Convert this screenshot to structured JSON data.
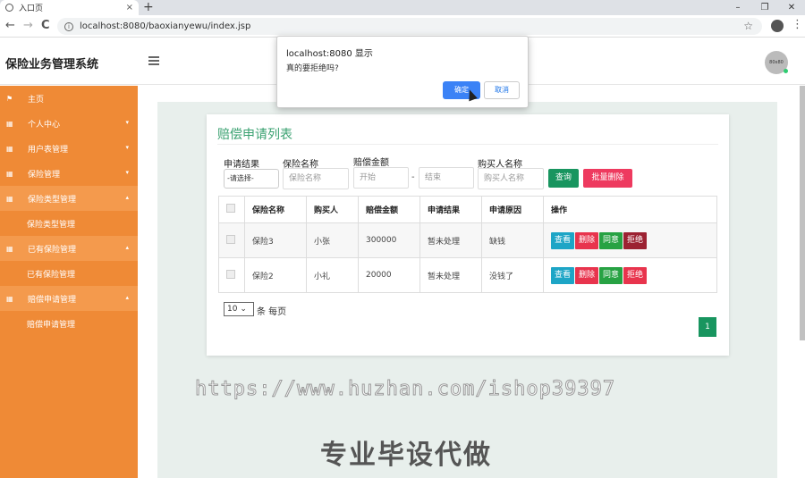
{
  "browser": {
    "tab_title": "入口页",
    "tab_close": "×",
    "new_tab": "+",
    "url": "localhost:8080/baoxianyewu/index.jsp",
    "back": "←",
    "forward": "→",
    "reload": "C",
    "info": "i",
    "star": "☆",
    "kebab": "⋮",
    "min": "–",
    "max": "❐",
    "close": "✕"
  },
  "header": {
    "title": "保险业务管理系统",
    "avatar_text": "80x80"
  },
  "sidebar": {
    "items": [
      {
        "label": "主页",
        "icon": "⚑",
        "type": "main"
      },
      {
        "label": "个人中心",
        "icon": "▦",
        "type": "group",
        "caret": "▾"
      },
      {
        "label": "用户表管理",
        "icon": "▦",
        "type": "group",
        "caret": "▾"
      },
      {
        "label": "保险管理",
        "icon": "▦",
        "type": "group",
        "caret": "▾"
      },
      {
        "label": "保险类型管理",
        "icon": "▦",
        "type": "group-open",
        "caret": "▴"
      },
      {
        "label": "保险类型管理",
        "type": "sub"
      },
      {
        "label": "已有保险管理",
        "icon": "▦",
        "type": "group-open",
        "caret": "▴"
      },
      {
        "label": "已有保险管理",
        "type": "sub"
      },
      {
        "label": "赔偿申请管理",
        "icon": "▦",
        "type": "group-open",
        "caret": "▴"
      },
      {
        "label": "赔偿申请管理",
        "type": "sub"
      }
    ]
  },
  "card": {
    "title": "赔偿申请列表"
  },
  "filters": {
    "result_label": "申请结果",
    "result_value": "-请选择-",
    "name_label": "保险名称",
    "name_placeholder": "保险名称",
    "amount_label": "赔偿金额",
    "amount_start": "开始",
    "amount_end": "结束",
    "amount_sep": "-",
    "buyer_label": "购买人名称",
    "buyer_placeholder": "购买人名称",
    "query_btn": "查询",
    "batch_delete_btn": "批量删除"
  },
  "table": {
    "headers": [
      "保险名称",
      "购买人",
      "赔偿金额",
      "申请结果",
      "申请原因",
      "操作"
    ],
    "rows": [
      {
        "name": "保险3",
        "buyer": "小张",
        "amount": "300000",
        "result": "暂未处理",
        "reason": "缺钱"
      },
      {
        "name": "保险2",
        "buyer": "小礼",
        "amount": "20000",
        "result": "暂未处理",
        "reason": "没钱了"
      }
    ],
    "actions": {
      "view": "查看",
      "delete": "删除",
      "agree": "同意",
      "reject": "拒绝"
    }
  },
  "pagination": {
    "page_size": "10 ⌄",
    "per_page_text": "条 每页",
    "current_page": "1"
  },
  "watermark": {
    "url": "https://www.huzhan.com/ishop39397",
    "slogan": "专业毕设代做"
  },
  "dialog": {
    "title": "localhost:8080 显示",
    "message": "真的要拒绝吗?",
    "ok": "确定",
    "cancel": "取消"
  }
}
